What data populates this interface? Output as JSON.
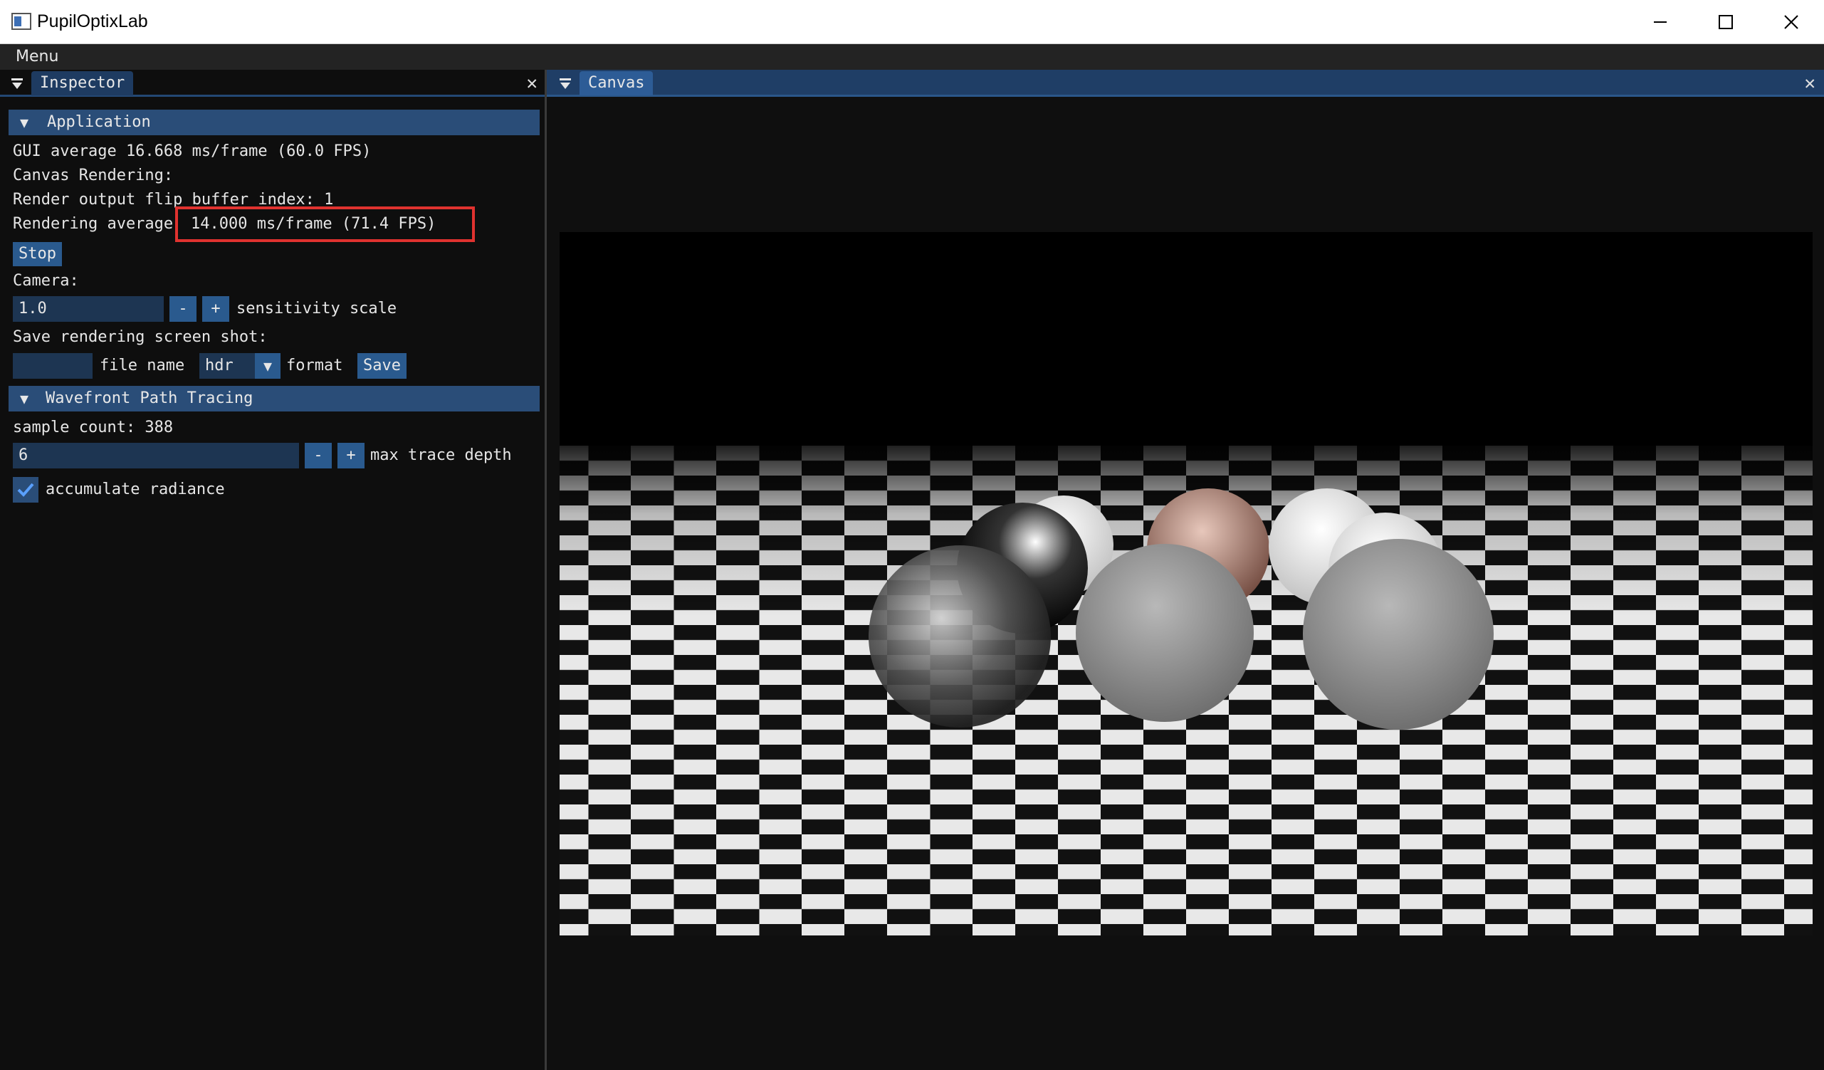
{
  "window": {
    "title": "PupilOptixLab",
    "minimize_icon": "minimize-icon",
    "maximize_icon": "maximize-icon",
    "close_icon": "close-icon"
  },
  "menubar": {
    "menu_label": "Menu"
  },
  "inspector": {
    "tab_label": "Inspector",
    "application": {
      "header": "Application",
      "gui_average": "GUI average 16.668 ms/frame (60.0 FPS)",
      "canvas_rendering": "Canvas Rendering:",
      "flip_buffer": "Render output flip buffer index: 1",
      "rendering_average_label": "Rendering average",
      "rendering_average_value": "14.000 ms/frame (71.4 FPS)",
      "stop_button": "Stop",
      "camera_label": "Camera:",
      "sensitivity_value": "1.0",
      "minus_label": "-",
      "plus_label": "+",
      "sensitivity_label": "sensitivity scale",
      "save_shot_label": "Save rendering screen shot:",
      "file_name_value": "",
      "file_name_label": "file name",
      "format_value": "hdr",
      "format_label": "format",
      "save_button": "Save"
    },
    "wavefront": {
      "header": "Wavefront Path Tracing",
      "sample_count": "sample count: 388",
      "max_depth_value": "6",
      "minus_label": "-",
      "plus_label": "+",
      "max_depth_label": "max trace depth",
      "accumulate_label": "accumulate radiance",
      "accumulate_checked": true
    }
  },
  "canvas": {
    "tab_label": "Canvas"
  },
  "colors": {
    "accent": "#2a5a8e",
    "header": "#2a4d78",
    "highlight_box": "#e0322f"
  }
}
